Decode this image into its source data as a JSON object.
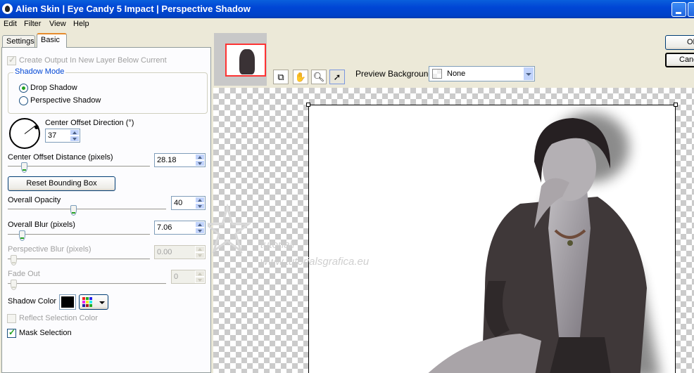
{
  "window": {
    "title": "Alien Skin | Eye Candy 5 Impact | Perspective Shadow"
  },
  "menu": [
    "Edit",
    "Filter",
    "View",
    "Help"
  ],
  "tabs": {
    "settings": "Settings",
    "basic": "Basic"
  },
  "basic": {
    "create_output_layer": {
      "label": "Create Output In New Layer Below Current",
      "checked": true,
      "enabled": false
    },
    "shadow_mode": {
      "label": "Shadow Mode",
      "options": [
        {
          "label": "Drop Shadow",
          "selected": true
        },
        {
          "label": "Perspective Shadow",
          "selected": false
        }
      ]
    },
    "center_offset_direction": {
      "label": "Center Offset Direction (°)",
      "value": "37"
    },
    "center_offset_distance": {
      "label": "Center Offset Distance (pixels)",
      "value": "28.18"
    },
    "reset_bounding_box": "Reset Bounding Box",
    "overall_opacity": {
      "label": "Overall Opacity",
      "value": "40"
    },
    "overall_blur": {
      "label": "Overall Blur (pixels)",
      "value": "7.06"
    },
    "perspective_blur": {
      "label": "Perspective Blur (pixels)",
      "value": "0.00",
      "enabled": false
    },
    "fade_out": {
      "label": "Fade Out",
      "value": "0",
      "enabled": false
    },
    "shadow_color": {
      "label": "Shadow Color",
      "color": "#000000"
    },
    "reflect_selection_color": {
      "label": "Reflect Selection Color",
      "checked": false,
      "enabled": false
    },
    "mask_selection": {
      "label": "Mask Selection",
      "checked": true
    }
  },
  "preview": {
    "background_label": "Preview Background:",
    "background_value": "None",
    "tools": [
      "navigator-icon",
      "hand-icon",
      "zoom-icon",
      "pointer-icon"
    ]
  },
  "buttons": {
    "ok": "OK",
    "cancel": "Cancel"
  },
  "watermark": {
    "line1": "tutoriali",
    "line2": "www.tutorialsgrafica.eu"
  }
}
